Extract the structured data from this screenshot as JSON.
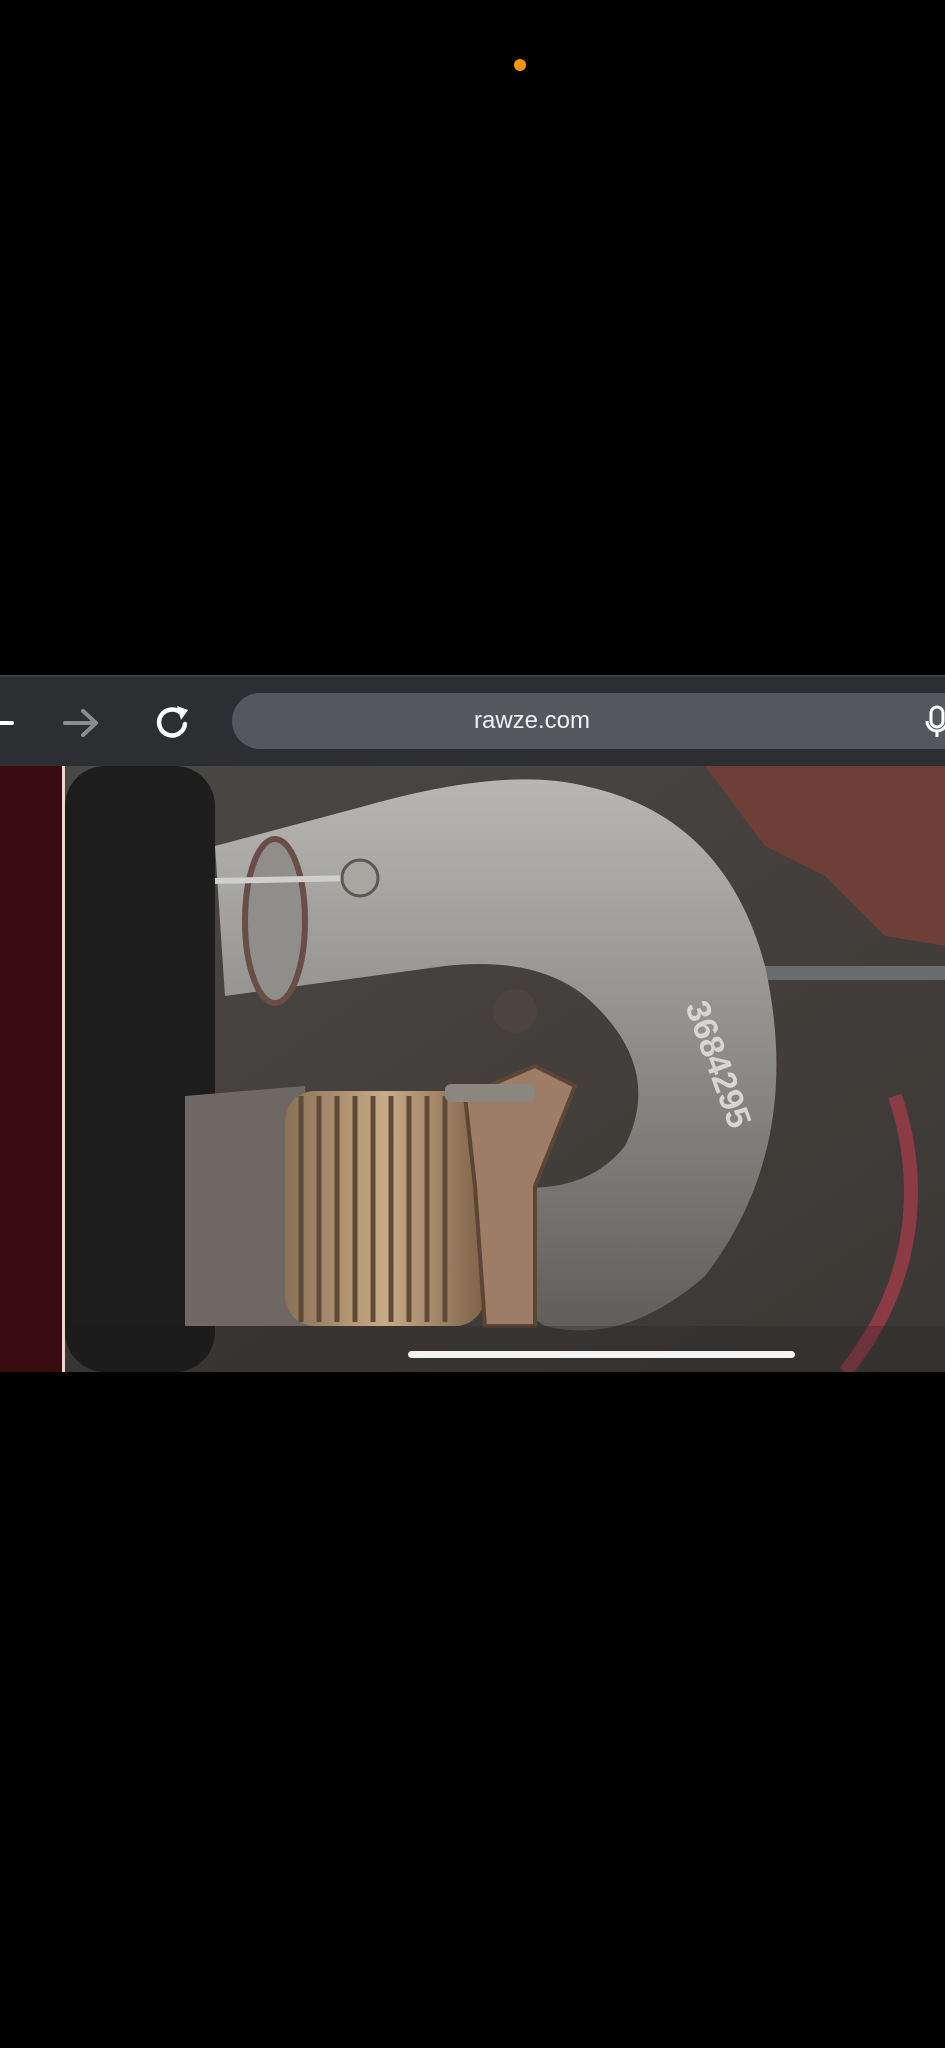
{
  "status": {
    "privacy_indicator_color": "#ff9500"
  },
  "browser_toolbar": {
    "back_icon": "back-arrow-icon",
    "forward_icon": "forward-arrow-icon",
    "reload_icon": "reload-icon",
    "url": "rawze.com",
    "mic_icon": "microphone-icon"
  },
  "content": {
    "image": {
      "subject": "engine-exhaust-pipe",
      "stamped_text": "3684295"
    }
  },
  "colors": {
    "toolbar_bg": "#2c2e31",
    "url_bar_bg": "#54585c",
    "left_strip": "#3a0b0f"
  }
}
